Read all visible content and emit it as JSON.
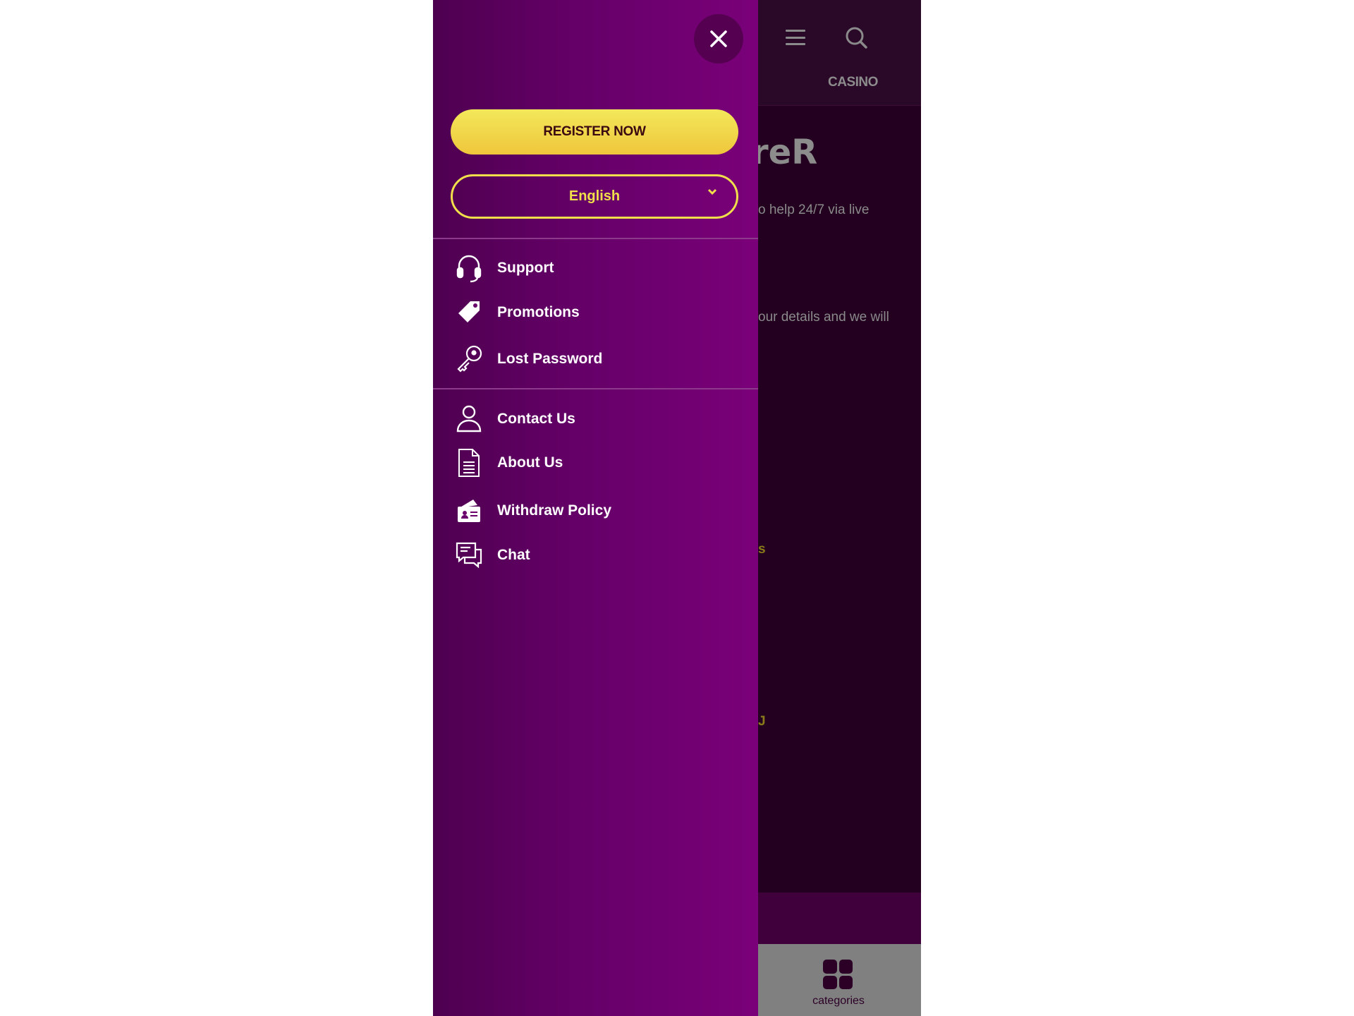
{
  "background_page": {
    "header": {
      "menu_icon": "hamburger-icon",
      "search_icon": "search-icon",
      "nav_label": "CASINO"
    },
    "title_fragment": "reR",
    "text_line_1": "o help 24/7 via live",
    "text_line_2": "our details and we will",
    "yellow_fragment_1": "s",
    "yellow_fragment_2": "J",
    "bottom_nav": {
      "categories_label": "categories",
      "icon": "grid-icon"
    }
  },
  "menu": {
    "close_icon": "close-icon",
    "register_label": "REGISTER NOW",
    "language": {
      "selected": "English",
      "icon": "chevron-down-icon"
    },
    "group1": [
      {
        "label": "Support",
        "icon": "headset-icon"
      },
      {
        "label": "Promotions",
        "icon": "tag-icon"
      },
      {
        "label": "Lost Password",
        "icon": "key-icon"
      }
    ],
    "group2": [
      {
        "label": "Contact Us",
        "icon": "user-icon"
      },
      {
        "label": "About Us",
        "icon": "document-icon"
      },
      {
        "label": "Withdraw Policy",
        "icon": "card-icon"
      },
      {
        "label": "Chat",
        "icon": "chat-icon"
      }
    ]
  },
  "colors": {
    "accent_yellow": "#f0df4a",
    "menu_purple": "#6a006b",
    "page_bg": "#230020"
  }
}
